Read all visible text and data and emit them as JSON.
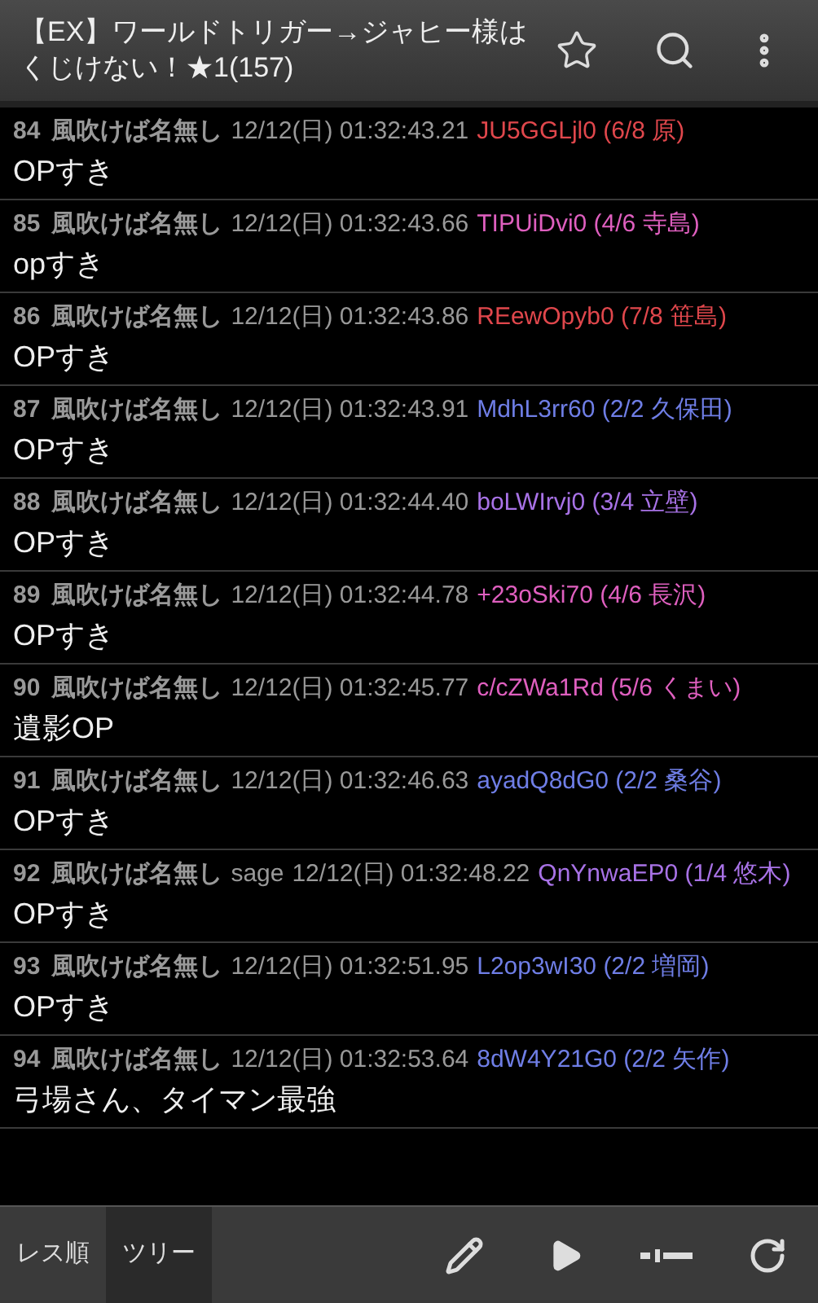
{
  "header": {
    "title": "【EX】ワールドトリガー→ジャヒー様はくじけない！★1(157)"
  },
  "posts": [
    {
      "number": "84",
      "name": "風吹けば名無し",
      "date": "12/12(日) 01:32:43.21",
      "id": "JU5GGLjl0 (6/8 原)",
      "color": "#e0474c",
      "body": "OPすき"
    },
    {
      "number": "85",
      "name": "風吹けば名無し",
      "date": "12/12(日) 01:32:43.66",
      "id": "TIPUiDvi0 (4/6 寺島)",
      "color": "#df5fbf",
      "body": "opすき"
    },
    {
      "number": "86",
      "name": "風吹けば名無し",
      "date": "12/12(日) 01:32:43.86",
      "id": "REewOpyb0 (7/8 笹島)",
      "color": "#e0474c",
      "body": "OPすき"
    },
    {
      "number": "87",
      "name": "風吹けば名無し",
      "date": "12/12(日) 01:32:43.91",
      "id": "MdhL3rr60 (2/2 久保田)",
      "color": "#6f7ee6",
      "body": "OPすき"
    },
    {
      "number": "88",
      "name": "風吹けば名無し",
      "date": "12/12(日) 01:32:44.40",
      "id": "boLWIrvj0 (3/4 立壁)",
      "color": "#a872e6",
      "body": "OPすき"
    },
    {
      "number": "89",
      "name": "風吹けば名無し",
      "date": "12/12(日) 01:32:44.78",
      "id": "+23oSki70 (4/6 長沢)",
      "color": "#df5fbf",
      "body": "OPすき"
    },
    {
      "number": "90",
      "name": "風吹けば名無し",
      "date": "12/12(日) 01:32:45.77",
      "id": "c/cZWa1Rd (5/6 くまい)",
      "color": "#df5fbf",
      "body": "遺影OP"
    },
    {
      "number": "91",
      "name": "風吹けば名無し",
      "date": "12/12(日) 01:32:46.63",
      "id": "ayadQ8dG0 (2/2 桑谷)",
      "color": "#6f7ee6",
      "body": "OPすき"
    },
    {
      "number": "92",
      "name": "風吹けば名無し",
      "mail": "sage",
      "date": "12/12(日) 01:32:48.22",
      "id": "QnYnwaEP0 (1/4 悠木)",
      "color": "#a872e6",
      "body": "OPすき"
    },
    {
      "number": "93",
      "name": "風吹けば名無し",
      "date": "12/12(日) 01:32:51.95",
      "id": "L2op3wI30 (2/2 増岡)",
      "color": "#6f7ee6",
      "body": "OPすき"
    },
    {
      "number": "94",
      "name": "風吹けば名無し",
      "date": "12/12(日) 01:32:53.64",
      "id": "8dW4Y21G0 (2/2 矢作)",
      "color": "#6f7ee6",
      "body": "弓場さん、タイマン最強"
    }
  ],
  "tabs": [
    {
      "label": "レス順",
      "selected": false
    },
    {
      "label": "ツリー",
      "selected": true
    }
  ]
}
